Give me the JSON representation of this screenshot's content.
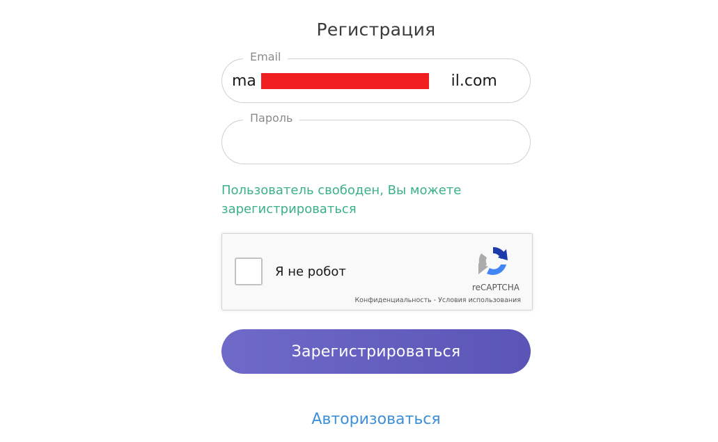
{
  "form": {
    "title": "Регистрация",
    "email": {
      "label": "Email",
      "value": "ma                                        il.com"
    },
    "password": {
      "label": "Пароль",
      "value": ""
    },
    "status_message": "Пользователь свободен, Вы можете зарегистрироваться",
    "status_color": "#3ab08a",
    "captcha": {
      "checkbox_label": "Я не робот",
      "brand": "reCAPTCHA",
      "links": "Конфиденциальность - Условия использования",
      "icon": "recaptcha-logo-icon"
    },
    "submit_label": "Зарегистрироваться",
    "submit_color": "#6160c0",
    "login_link": "Авторизоваться",
    "link_color": "#3d8fd8",
    "redaction_color": "#f01e1e"
  }
}
